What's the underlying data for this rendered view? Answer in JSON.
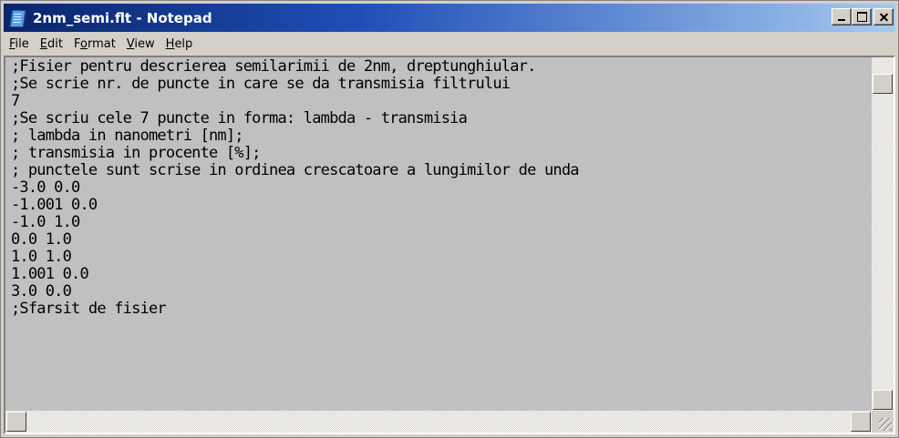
{
  "window": {
    "title": "2nm_semi.flt - Notepad",
    "app_icon": "notepad-icon",
    "controls": {
      "minimize": "minimize-icon",
      "maximize": "maximize-icon",
      "close": "close-icon"
    }
  },
  "menu": [
    {
      "label": "File",
      "accel": "F"
    },
    {
      "label": "Edit",
      "accel": "E"
    },
    {
      "label": "Format",
      "accel": "o"
    },
    {
      "label": "View",
      "accel": "V"
    },
    {
      "label": "Help",
      "accel": "H"
    }
  ],
  "editor": {
    "lines": [
      ";Fisier pentru descrierea semilarimii de 2nm, dreptunghiular.",
      ";Se scrie nr. de puncte in care se da transmisia filtrului",
      "7",
      ";Se scriu cele 7 puncte in forma: lambda - transmisia",
      "; lambda in nanometri [nm];",
      "; transmisia in procente [%];",
      "; punctele sunt scrise in ordinea crescatoare a lungimilor de unda",
      "-3.0 0.0",
      "-1.001 0.0",
      "-1.0 1.0",
      "0.0 1.0",
      "1.0 1.0",
      "1.001 0.0",
      "3.0 0.0",
      ";Sfarsit de fisier"
    ]
  },
  "colors": {
    "title_start": "#0a246a",
    "title_end": "#a6caf0",
    "editor_bg": "#c0c0c0",
    "chrome": "#d4d0c8"
  }
}
